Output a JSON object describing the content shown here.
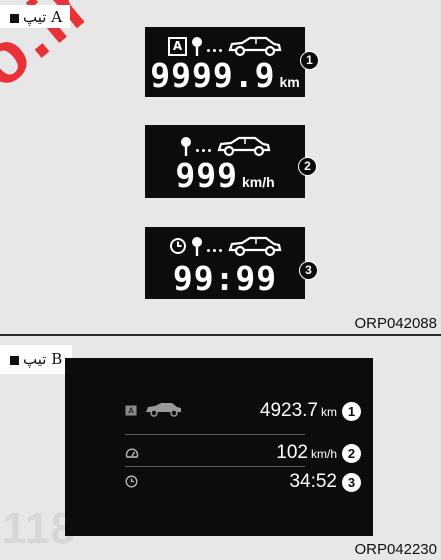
{
  "typeA": {
    "tag": "تیپ A",
    "figure_ref": "ORP042088",
    "displays": [
      {
        "number": "1",
        "value": "9999.9",
        "unit": "km",
        "icons": [
          "a-box-icon",
          "location-pin-icon",
          "car-icon"
        ]
      },
      {
        "number": "2",
        "value": "999",
        "unit": "km/h",
        "icons": [
          "location-pin-icon",
          "car-icon"
        ]
      },
      {
        "number": "3",
        "value": "99:99",
        "unit": "",
        "icons": [
          "clock-icon",
          "location-pin-icon",
          "car-icon"
        ]
      }
    ]
  },
  "typeB": {
    "tag": "تیپ B",
    "figure_ref": "ORP042230",
    "rows": [
      {
        "number": "1",
        "value": "4923.7",
        "unit": "km",
        "icon": "car-icon"
      },
      {
        "number": "2",
        "value": "102",
        "unit": "km/h",
        "icon": "gauge-icon"
      },
      {
        "number": "3",
        "value": "34:52",
        "unit": "",
        "icon": "clock-icon"
      }
    ]
  },
  "watermarks": {
    "corner": "o.ir",
    "bottom": "118"
  },
  "colors": {
    "lcd": "#0c0c0c",
    "page": "#e7e7e7",
    "watermark": "#e8232a"
  }
}
